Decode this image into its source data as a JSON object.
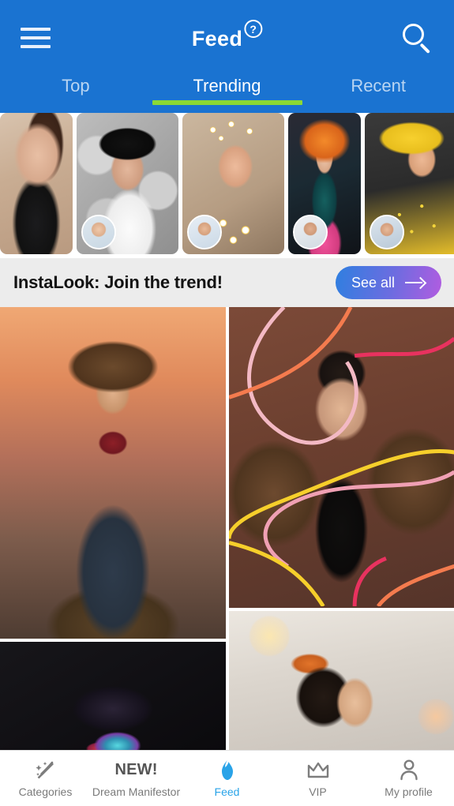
{
  "header": {
    "title": "Feed",
    "help_badge": "?",
    "menu_icon": "hamburger-menu-icon",
    "search_icon": "search-icon",
    "background_color": "#1a73d1",
    "tabs": [
      {
        "label": "Top",
        "active": false
      },
      {
        "label": "Trending",
        "active": true
      },
      {
        "label": "Recent",
        "active": false
      }
    ],
    "active_tab_indicator_color": "#8bd836"
  },
  "stories": {
    "items": [
      {
        "name": "story-card-1",
        "description": "woman in black crop top pointing"
      },
      {
        "name": "story-card-2",
        "description": "woman in black wide hat and white blazer"
      },
      {
        "name": "story-card-3",
        "description": "woman with daisy flower crown and bouquet"
      },
      {
        "name": "story-card-4",
        "description": "woman in gown with orange fairy wings"
      },
      {
        "name": "story-card-5",
        "description": "woman in yellow hat with polka dot dress"
      }
    ]
  },
  "banner": {
    "title": "InstaLook: Join the trend!",
    "see_all_label": "See all",
    "arrow_icon": "arrow-right-icon",
    "gradient_start": "#2f7fe0",
    "gradient_end": "#b15ce0",
    "background_color": "#ececec"
  },
  "grid": {
    "left": [
      {
        "name": "feed-card-cowboy",
        "description": "cowboy in hat and vest at sunset"
      },
      {
        "name": "feed-card-dark-neon",
        "description": "dark portrait with hat and neon lit face"
      }
    ],
    "right": [
      {
        "name": "feed-card-leather-jacket",
        "description": "woman in brown leather jacket by brick wall with colored line overlay"
      },
      {
        "name": "feed-card-bokeh-profile",
        "description": "woman profile with warm bokeh lights"
      }
    ]
  },
  "bottom_nav": {
    "active_color": "#29a3e8",
    "inactive_color": "#7a7a7a",
    "items": [
      {
        "label": "Categories",
        "icon": "magic-wand-icon",
        "active": false
      },
      {
        "label": "Dream Manifestor",
        "icon": "new-text-badge",
        "badge": "NEW!",
        "active": false
      },
      {
        "label": "Feed",
        "icon": "flame-icon",
        "active": true
      },
      {
        "label": "VIP",
        "icon": "crown-icon",
        "active": false
      },
      {
        "label": "My profile",
        "icon": "person-icon",
        "active": false
      }
    ]
  }
}
